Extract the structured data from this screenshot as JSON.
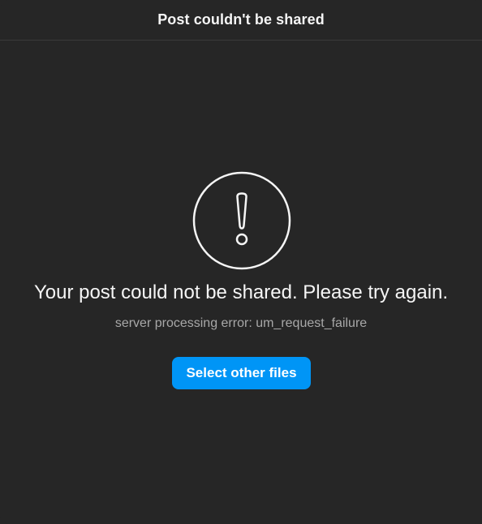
{
  "dialog": {
    "title": "Post couldn't be shared",
    "icon": "alert-exclamation-icon",
    "message": "Your post could not be shared. Please try again.",
    "detail": "server processing error: um_request_failure",
    "action_label": "Select other files"
  },
  "colors": {
    "background": "#262626",
    "text": "#f5f5f5",
    "secondary_text": "#a8a8a8",
    "accent": "#0095f6",
    "divider": "#3a3a3a"
  }
}
